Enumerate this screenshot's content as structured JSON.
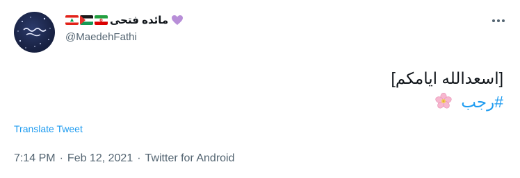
{
  "author": {
    "display_name": "مائده فتحی",
    "handle": "@MaedehFathi",
    "avatar_text": "مائده فتحی",
    "flags": [
      "lebanon-flag-icon",
      "palestine-flag-icon",
      "iran-flag-icon"
    ],
    "heart_icon": "purple-heart-icon",
    "heart_color": "#b88ed8"
  },
  "tweet": {
    "line1": "[اسعدالله ایامکم]",
    "hashtag": "#رجب",
    "emoji_icon": "cherry-blossom-icon"
  },
  "actions": {
    "translate_label": "Translate Tweet",
    "more_icon": "more-options-icon"
  },
  "meta": {
    "time": "7:14 PM",
    "date": "Feb 12, 2021",
    "source": "Twitter for Android",
    "separator": "·"
  },
  "colors": {
    "link": "#1d9bf0",
    "secondary_text": "#536471",
    "primary_text": "#0f1419"
  }
}
